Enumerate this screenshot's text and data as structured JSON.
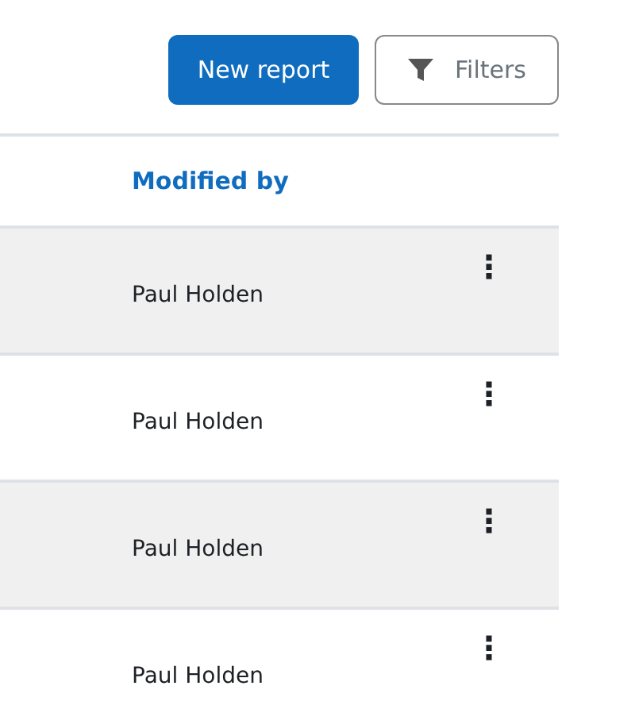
{
  "toolbar": {
    "primary_button": "New report",
    "filter_button": "Filters"
  },
  "table": {
    "columns": [
      {
        "label": "Modified by"
      }
    ],
    "rows": [
      {
        "modified_by": "Paul Holden",
        "menu": "⋮"
      },
      {
        "modified_by": "Paul Holden",
        "menu": "⋮"
      },
      {
        "modified_by": "Paul Holden",
        "menu": "⋮"
      },
      {
        "modified_by": "Paul Holden",
        "menu": "⋮"
      }
    ]
  }
}
